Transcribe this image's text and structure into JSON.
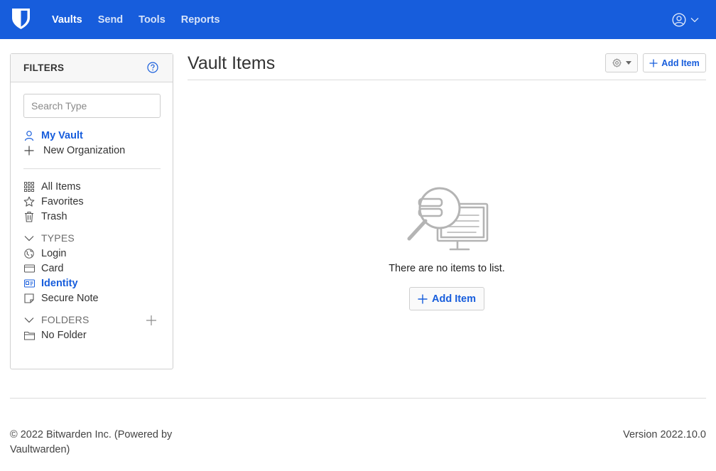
{
  "nav": {
    "links": [
      "Vaults",
      "Send",
      "Tools",
      "Reports"
    ]
  },
  "filters": {
    "title": "FILTERS",
    "search_placeholder": "Search Type",
    "my_vault": "My Vault",
    "new_org": "New Organization",
    "all_items": "All Items",
    "favorites": "Favorites",
    "trash": "Trash",
    "types_header": "TYPES",
    "types": [
      "Login",
      "Card",
      "Identity",
      "Secure Note"
    ],
    "folders_header": "FOLDERS",
    "no_folder": "No Folder"
  },
  "main": {
    "title": "Vault Items",
    "add_item": "Add Item",
    "empty_text": "There are no items to list.",
    "add_item_center": "Add Item"
  },
  "footer": {
    "copyright": "© 2022 Bitwarden Inc. (Powered by Vaultwarden)",
    "version": "Version 2022.10.0"
  },
  "colors": {
    "brand": "#175ddc",
    "active": "#175ddc"
  }
}
